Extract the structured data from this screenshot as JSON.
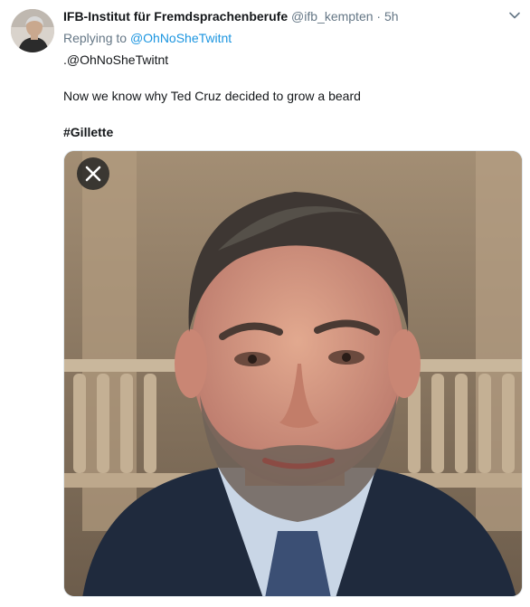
{
  "tweet": {
    "author_name": "IFB-Institut für Fremdsprachenberufe",
    "author_handle": "@ifb_kempten",
    "separator": "·",
    "timestamp": "5h",
    "reply_prefix": "Replying to",
    "reply_to": "@OhNoSheTwitnt",
    "mention_line": ".@OhNoSheTwitnt",
    "body": "Now we know why Ted Cruz decided to grow a beard",
    "hashtag": "#Gillette"
  },
  "colors": {
    "link": "#1b95e0",
    "secondary_text": "#657786",
    "primary_text": "#14171a",
    "media_close_bg": "rgba(20,23,26,0.75)"
  },
  "icons": {
    "caret": "chevron-down-icon",
    "media_close": "close-icon"
  }
}
